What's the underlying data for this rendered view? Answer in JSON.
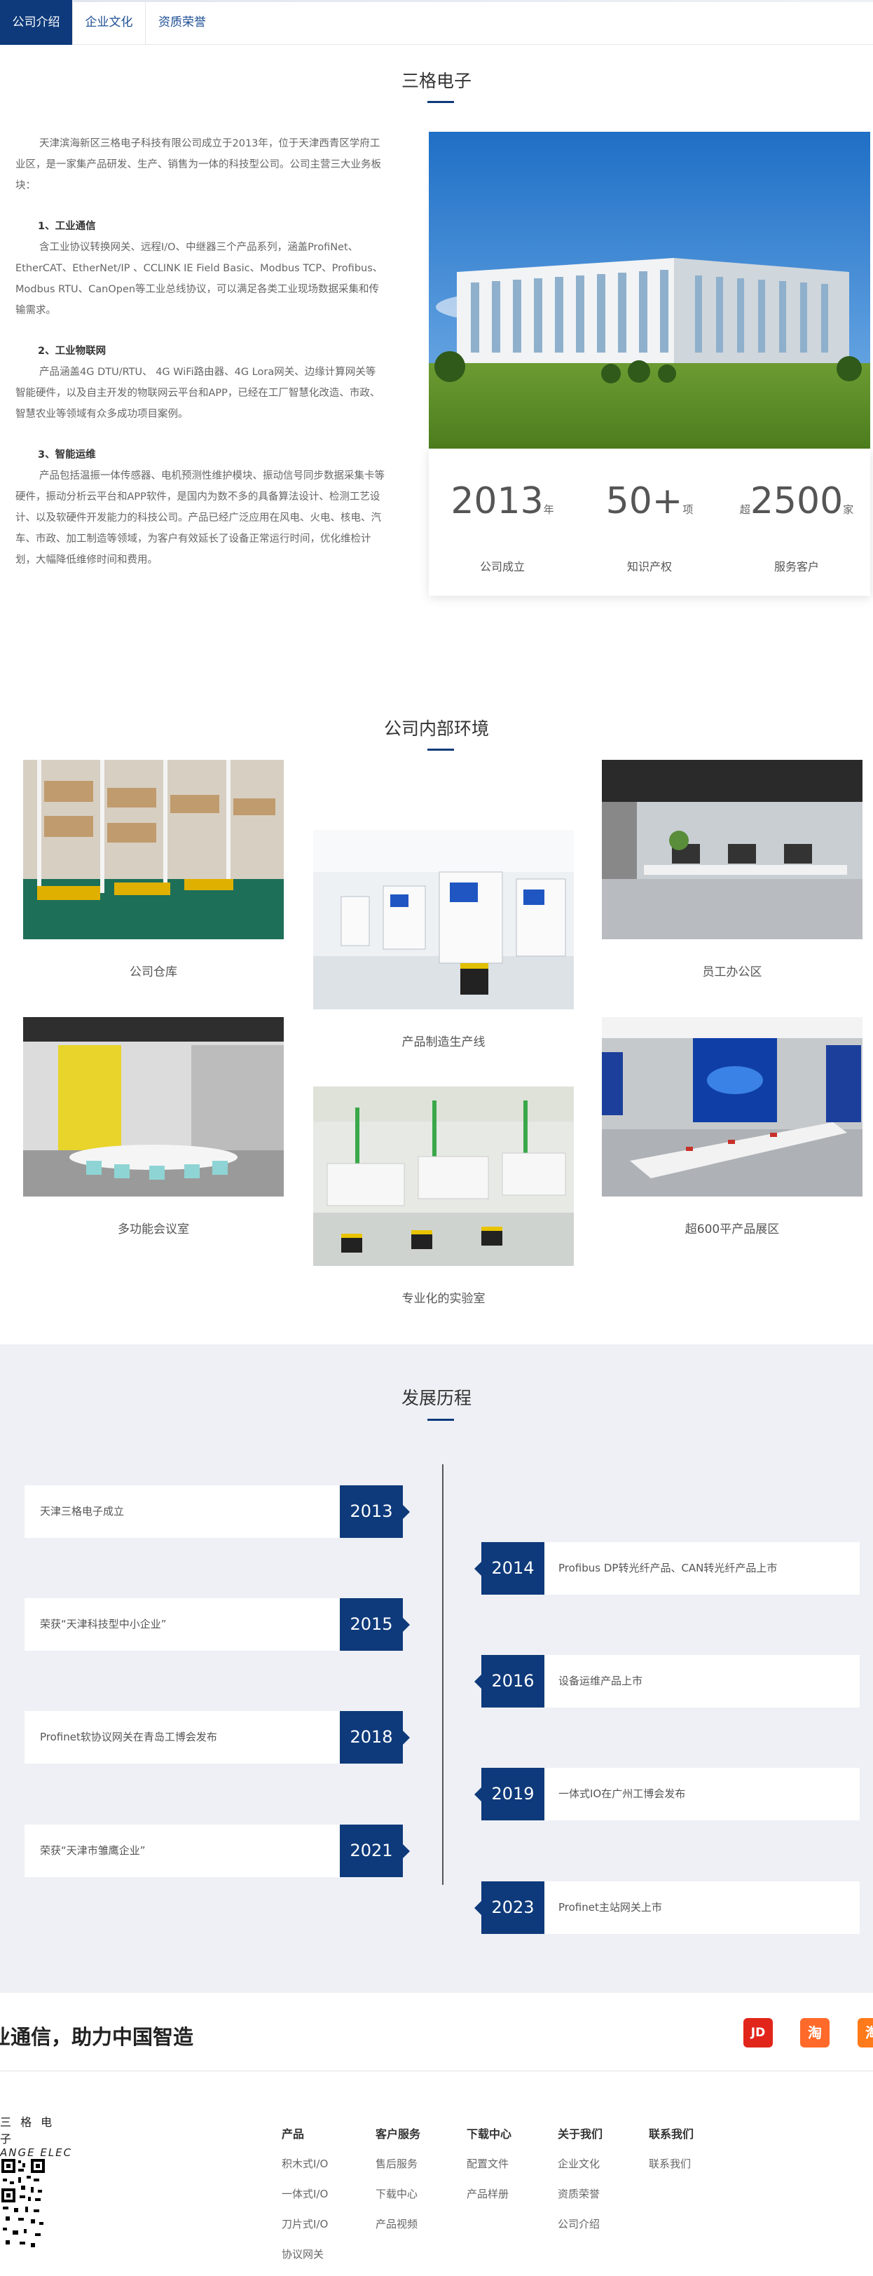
{
  "tabs": [
    {
      "label": "公司介绍"
    },
    {
      "label": "企业文化"
    },
    {
      "label": "资质荣誉"
    }
  ],
  "intro": {
    "title": "三格电子",
    "p1": "天津滨海新区三格电子科技有限公司成立于2013年，位于天津西青区学府工业区，是一家集产品研发、生产、销售为一体的科技型公司。公司主营三大业务板块：",
    "h1": "1、工业通信",
    "p2": "含工业协议转换网关、远程I/O、中继器三个产品系列，涵盖ProfiNet、EtherCAT、EtherNet/IP 、CCLINK IE Field Basic、Modbus TCP、Profibus、Modbus RTU、CanOpen等工业总线协议，可以满足各类工业现场数据采集和传输需求。",
    "h2": "2、工业物联网",
    "p3": "产品涵盖4G DTU/RTU、 4G WiFi路由器、4G Lora网关、边缘计算网关等智能硬件，以及自主开发的物联网云平台和APP，已经在工厂智慧化改造、市政、智慧农业等领域有众多成功项目案例。",
    "h3": "3、智能运维",
    "p4": "产品包括温振一体传感器、电机预测性维护模块、振动信号同步数据采集卡等硬件，振动分析云平台和APP软件，是国内为数不多的具备算法设计、检测工艺设计、以及软硬件开发能力的科技公司。产品已经广泛应用在风电、火电、核电、汽车、市政、加工制造等领域，为客户有效延长了设备正常运行时间，优化维检计划，大幅降低维修时间和费用。"
  },
  "stats": [
    {
      "prefix": "",
      "value": "2013",
      "unit": "年",
      "label": "公司成立"
    },
    {
      "prefix": "",
      "value": "50+",
      "unit": "项",
      "label": "知识产权"
    },
    {
      "prefix": "超",
      "value": "2500",
      "unit": "家",
      "label": "服务客户"
    }
  ],
  "environment": {
    "title": "公司内部环境",
    "items": [
      {
        "caption": "公司仓库"
      },
      {
        "caption": "产品制造生产线"
      },
      {
        "caption": "员工办公区"
      },
      {
        "caption": "多功能会议室"
      },
      {
        "caption": "专业化的实验室"
      },
      {
        "caption": "超600平产品展区"
      }
    ]
  },
  "history": {
    "title": "发展历程",
    "left": [
      {
        "text": "天津三格电子成立",
        "year": "2013"
      },
      {
        "text": "荣获“天津科技型中小企业”",
        "year": "2015"
      },
      {
        "text": "Profinet软协议网关在青岛工博会发布",
        "year": "2018"
      },
      {
        "text": "荣获“天津市雏鹰企业”",
        "year": "2021"
      }
    ],
    "right": [
      {
        "text": "Profibus DP转光纤产品、CAN转光纤产品上市",
        "year": "2014"
      },
      {
        "text": "设备运维产品上市",
        "year": "2016"
      },
      {
        "text": "一体式IO在广州工博会发布",
        "year": "2019"
      },
      {
        "text": "Profinet主站网关上市",
        "year": "2023"
      }
    ]
  },
  "banner": {
    "slogan": "业通信，助力中国智造",
    "shops": [
      {
        "icon": "jd-icon",
        "label": "JD",
        "color": "#e1251b"
      },
      {
        "icon": "taobao-icon",
        "label": "淘",
        "color": "#ff5000"
      },
      {
        "icon": "tmall-icon",
        "label": "淘",
        "color": "#ff6a00"
      }
    ]
  },
  "footer": {
    "logo_cn": "三 格 电 子",
    "logo_en": "ANGE ELEC",
    "columns": [
      {
        "title": "产品",
        "items": [
          "积木式I/O",
          "一体式I/O",
          "刀片式I/O",
          "协议网关"
        ]
      },
      {
        "title": "客户服务",
        "items": [
          "售后服务",
          "下载中心",
          "产品视频"
        ]
      },
      {
        "title": "下载中心",
        "items": [
          "配置文件",
          "产品样册"
        ]
      },
      {
        "title": "关于我们",
        "items": [
          "企业文化",
          "资质荣誉",
          "公司介绍"
        ]
      },
      {
        "title": "联系我们",
        "items": [
          "联系我们"
        ]
      }
    ]
  }
}
